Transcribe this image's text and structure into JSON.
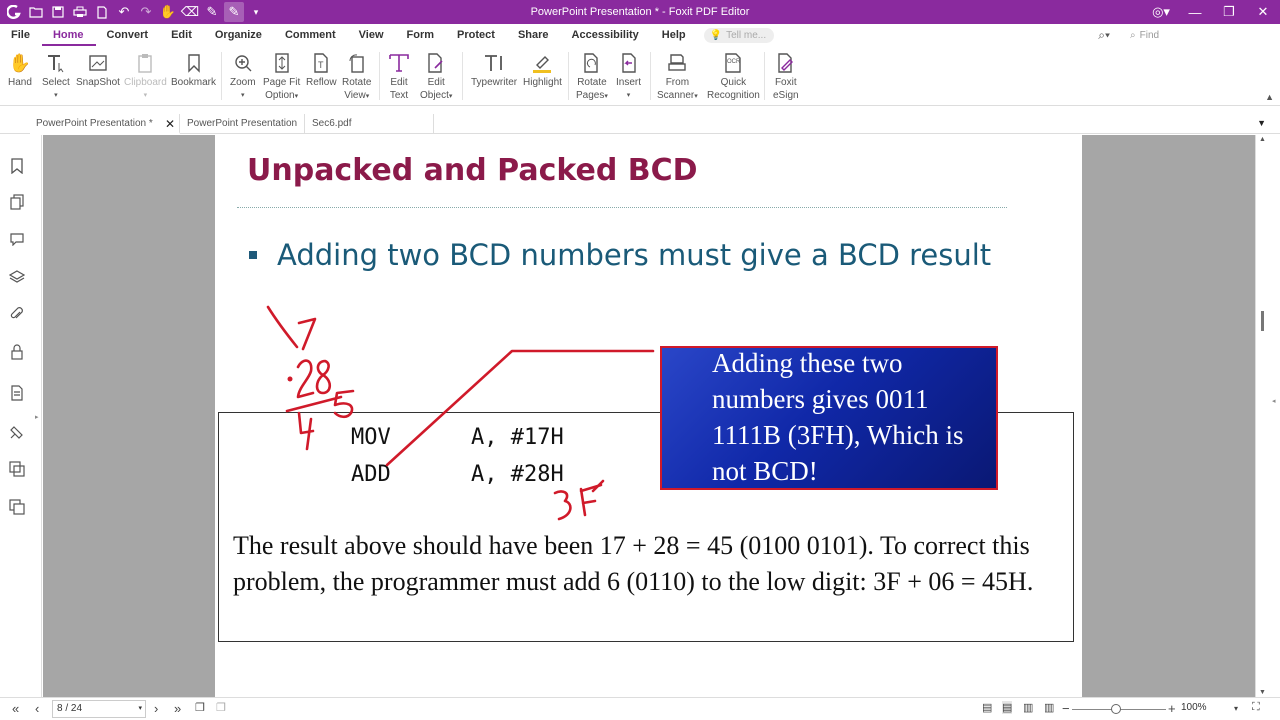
{
  "app": {
    "title": "PowerPoint Presentation * - Foxit PDF Editor"
  },
  "menu": {
    "items": [
      "File",
      "Home",
      "Convert",
      "Edit",
      "Organize",
      "Comment",
      "View",
      "Form",
      "Protect",
      "Share",
      "Accessibility",
      "Help"
    ],
    "active": "Home",
    "tell_me_placeholder": "Tell me...",
    "find_placeholder": "Find"
  },
  "ribbon": {
    "hand": "Hand",
    "select": "Select",
    "snapshot": "SnapShot",
    "clipboard": "Clipboard",
    "bookmark": "Bookmark",
    "zoom": "Zoom",
    "page_fit_1": "Page Fit",
    "page_fit_2": "Option",
    "reflow": "Reflow",
    "rotate_view_1": "Rotate",
    "rotate_view_2": "View",
    "edit_text_1": "Edit",
    "edit_text_2": "Text",
    "edit_object_1": "Edit",
    "edit_object_2": "Object",
    "typewriter": "Typewriter",
    "highlight": "Highlight",
    "rotate_pages_1": "Rotate",
    "rotate_pages_2": "Pages",
    "insert": "Insert",
    "from_scanner_1": "From",
    "from_scanner_2": "Scanner",
    "quick_rec_1": "Quick",
    "quick_rec_2": "Recognition",
    "foxit_esign_1": "Foxit",
    "foxit_esign_2": "eSign",
    "ocr_badge": "OCR"
  },
  "tabs": [
    {
      "label": "PowerPoint Presentation *"
    },
    {
      "label": "PowerPoint Presentation"
    },
    {
      "label": "Sec6.pdf"
    }
  ],
  "slide": {
    "title": "Unpacked and Packed BCD",
    "bullet": "Adding two BCD numbers must give a BCD result",
    "code": {
      "l1_op": "MOV",
      "l1_args": "A, #17H",
      "l2_op": "ADD",
      "l2_args": "A, #28H"
    },
    "explanation": "The result above should have been 17 + 28 = 45 (0100 0101). To correct this problem, the programmer must add 6 (0110) to the low digit: 3F + 06 = 45H.",
    "callout": "Adding these two numbers gives 0011 1111B (3FH), Which is not BCD!"
  },
  "annotations": {
    "hw_17": "17",
    "hw_28": "28",
    "hw_45": "45",
    "hw_3f": "3F",
    "ink_color": "#d01a2a"
  },
  "status": {
    "page": "8 / 24",
    "zoom": "100%",
    "zoom_fraction": 0.47
  },
  "colors": {
    "brand": "#8a2a9e",
    "slide_title": "#8b1a4a",
    "bullet_text": "#1a5a78",
    "callout_bg": "#1028a8",
    "callout_border": "#d01a2a"
  }
}
